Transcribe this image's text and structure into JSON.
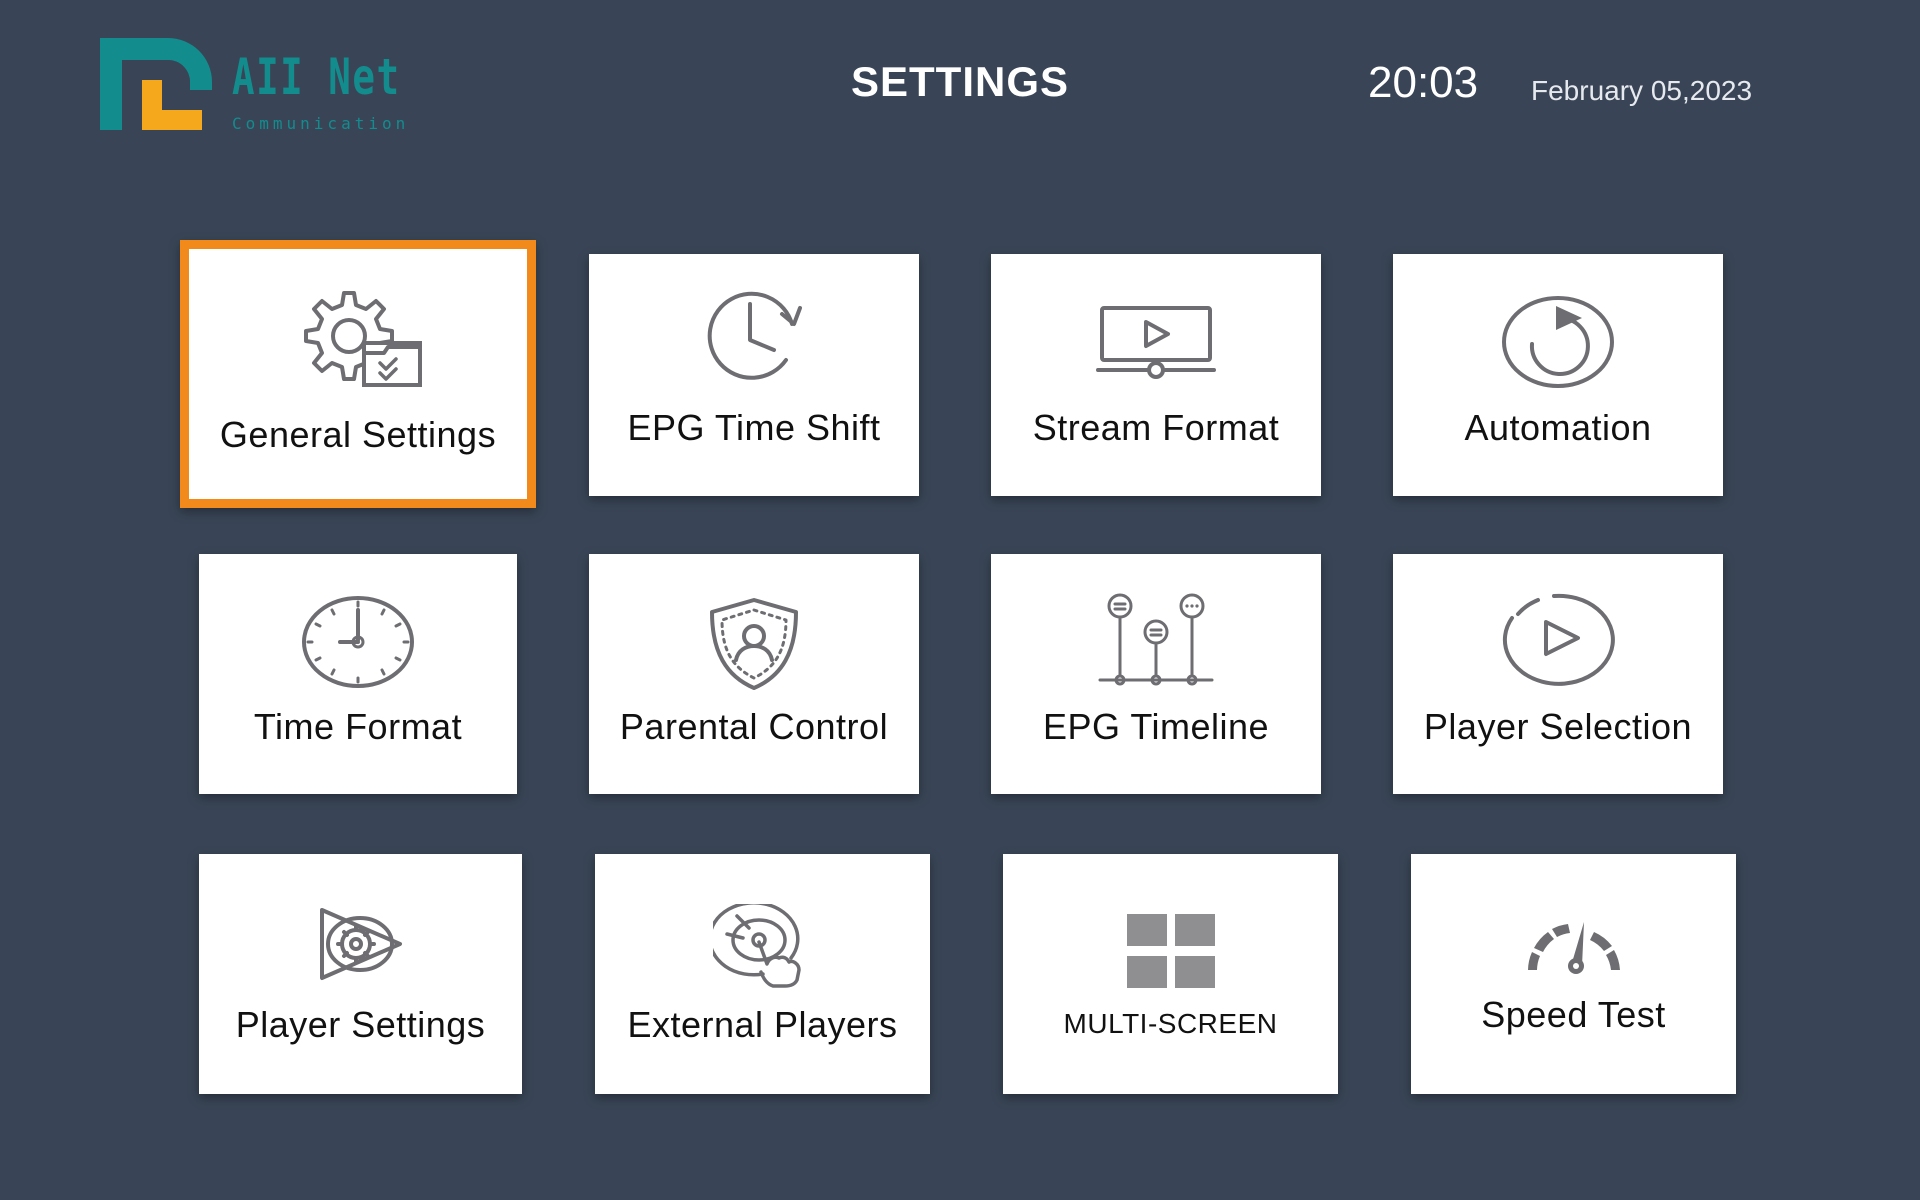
{
  "header": {
    "logo_main": "AII Net",
    "logo_sub": "Communication",
    "title": "SETTINGS",
    "time": "20:03",
    "date": "February 05,2023"
  },
  "tiles": [
    {
      "label": "General Settings",
      "icon": "gear-settings-icon",
      "focused": true
    },
    {
      "label": "EPG Time Shift",
      "icon": "clock-rotate-icon"
    },
    {
      "label": "Stream Format",
      "icon": "video-monitor-icon"
    },
    {
      "label": "Automation",
      "icon": "refresh-circle-icon"
    },
    {
      "label": "Time Format",
      "icon": "clock-icon"
    },
    {
      "label": "Parental Control",
      "icon": "shield-user-icon"
    },
    {
      "label": "EPG Timeline",
      "icon": "timeline-icon"
    },
    {
      "label": "Player Selection",
      "icon": "play-circle-icon"
    },
    {
      "label": "Player Settings",
      "icon": "player-gear-icon"
    },
    {
      "label": "External Players",
      "icon": "disc-hand-icon"
    },
    {
      "label": "MULTI-SCREEN",
      "icon": "grid-icon"
    },
    {
      "label": "Speed Test",
      "icon": "speedometer-icon"
    }
  ],
  "colors": {
    "background": "#394556",
    "focus": "#f28a1b",
    "logo_teal": "#138c8e",
    "logo_orange": "#f6a81c"
  }
}
